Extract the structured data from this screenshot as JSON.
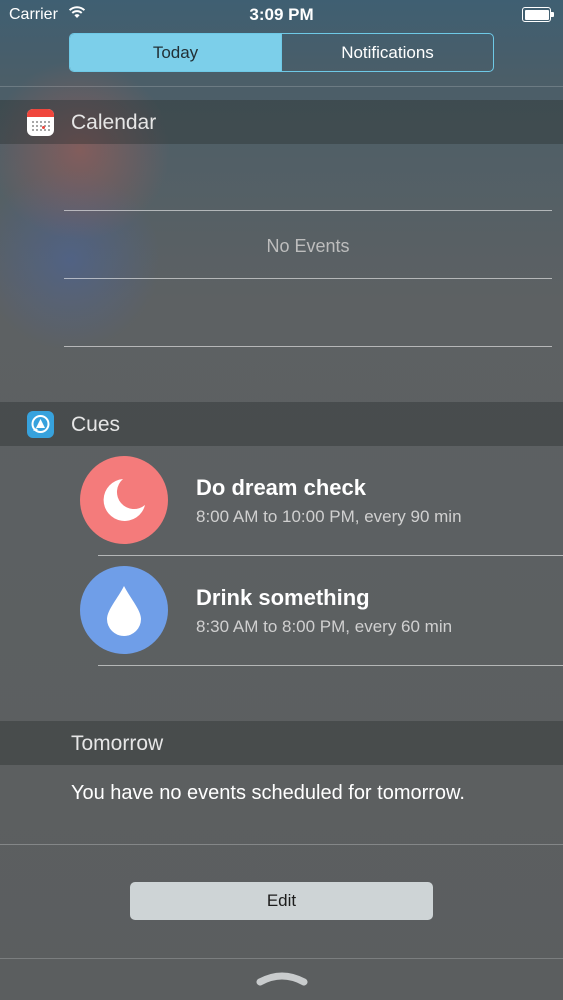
{
  "status_bar": {
    "carrier": "Carrier",
    "time": "3:09 PM"
  },
  "segmented": {
    "tabs": [
      {
        "label": "Today",
        "selected": true
      },
      {
        "label": "Notifications",
        "selected": false
      }
    ]
  },
  "calendar": {
    "title": "Calendar",
    "empty_text": "No Events",
    "icon": "calendar-icon"
  },
  "cues": {
    "title": "Cues",
    "icon": "cues-icon",
    "items": [
      {
        "title": "Do dream check",
        "subtitle": "8:00 AM to 10:00 PM, every 90 min",
        "icon": "moon-icon",
        "color": "#f47b7b"
      },
      {
        "title": "Drink something",
        "subtitle": "8:30 AM to 8:00 PM, every 60 min",
        "icon": "water-drop-icon",
        "color": "#6f9ee8"
      }
    ]
  },
  "tomorrow": {
    "title": "Tomorrow",
    "text": "You have no events scheduled for tomorrow."
  },
  "edit_label": "Edit",
  "colors": {
    "segment_accent": "#7ccfea",
    "calendar_red": "#f0463c",
    "cues_blue": "#37a2dd"
  }
}
